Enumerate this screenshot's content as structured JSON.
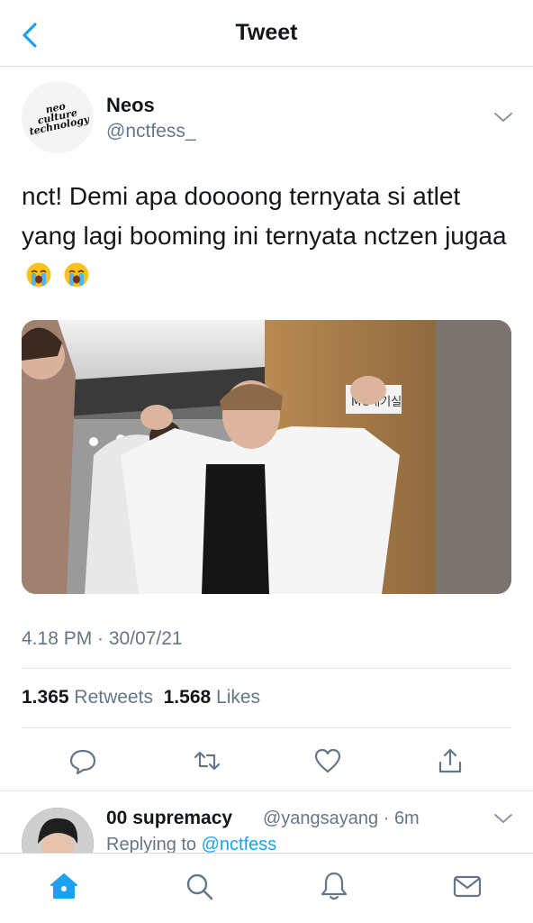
{
  "header": {
    "title": "Tweet",
    "back_icon": "chevron-left-icon"
  },
  "tweet": {
    "author_name": "Neos",
    "author_handle": "@nctfess_",
    "avatar_text": [
      "neo",
      "culture",
      "technology"
    ],
    "text": "nct! Demi apa doooong ternyata si atlet yang lagi booming ini ternyata nctzen jugaa",
    "emojis": [
      "loudly-crying-face",
      "loudly-crying-face"
    ],
    "media_sign_text": "MC대기실",
    "timestamp": "4.18 PM · 30/07/21",
    "retweets_count": "1.365",
    "retweets_label": "Retweets",
    "likes_count": "1.568",
    "likes_label": "Likes"
  },
  "actions": [
    "reply-icon",
    "retweet-icon",
    "like-icon",
    "share-icon"
  ],
  "reply": {
    "name": "00 supremacy",
    "handle_time": "@yangsayang · 6m",
    "replying_prefix": "Replying to",
    "replying_handle": "@nctfess"
  },
  "tabbar": [
    "home-icon",
    "search-icon",
    "notifications-icon",
    "messages-icon"
  ],
  "colors": {
    "accent": "#1da1f2",
    "muted": "#657786",
    "text": "#14171a"
  }
}
